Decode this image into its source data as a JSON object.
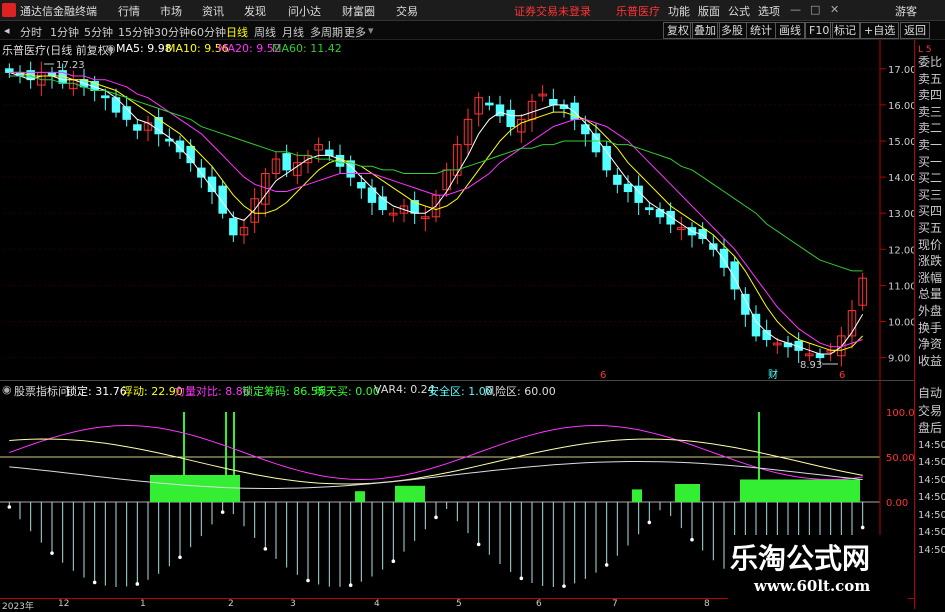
{
  "menubar": {
    "app_name": "通达信金融终端",
    "items": [
      "行情",
      "市场",
      "资讯",
      "发现",
      "问小达",
      "财富圈",
      "交易"
    ],
    "alert": "证券交易未登录",
    "stock": "乐普医疗",
    "right_items": [
      "功能",
      "版面",
      "公式",
      "选项"
    ],
    "guest": "游客"
  },
  "periodbar": {
    "periods": [
      "分时",
      "1分钟",
      "5分钟",
      "15分钟",
      "30分钟",
      "60分钟",
      "日线",
      "周线",
      "月线",
      "多周期",
      "更多"
    ],
    "active": "日线",
    "buttons": [
      "复权",
      "叠加",
      "多股",
      "统计",
      "画线",
      "F10",
      "标记",
      "+自选",
      "返回"
    ]
  },
  "main_info": {
    "title": "乐普医疗(日线 前复权)",
    "ma5": "MA5: 9.98",
    "ma10": "MA10: 9.56",
    "ma20": "MA20: 9.52",
    "ma60": "MA60: 11.42"
  },
  "price_axis": [
    "17.00",
    "16.00",
    "15.00",
    "14.00",
    "13.00",
    "12.00",
    "11.00",
    "10.00",
    "9.00"
  ],
  "annotations": {
    "high": "17.23",
    "low": "8.93"
  },
  "markers": {
    "m1": "6",
    "m2": "财",
    "m3": "6"
  },
  "sub_info": {
    "title": "股票指标问",
    "lock": "锁定: 31.76",
    "float": "浮动: 22.90",
    "power": "力量对比: 8.86",
    "chips": "锁定筹码: 86.55",
    "tomorrow": "明天买: 0.00",
    "var4": "VAR4: 0.24",
    "safe": "安全区: 1.00",
    "risk": "风险区: 60.00"
  },
  "sub_axis": [
    "100.0",
    "50.00",
    "0.00"
  ],
  "side_labels": [
    "委比",
    "卖五",
    "卖四",
    "卖三",
    "卖二",
    "卖一",
    "买一",
    "买二",
    "买三",
    "买四",
    "买五",
    "现价",
    "涨跌",
    "涨幅",
    "总量",
    "外盘",
    "换手",
    "净资",
    "收益"
  ],
  "side_lower": [
    "自动",
    "交易",
    "盘后",
    "14:50",
    "14:50",
    "14:50",
    "14:50",
    "14:50",
    "14:50",
    "14:50"
  ],
  "side_tag": "L 5",
  "time_axis": [
    "2023年",
    "12",
    "1",
    "2",
    "3",
    "4",
    "5",
    "6",
    "7",
    "8"
  ],
  "watermark": {
    "line1": "乐淘公式网",
    "line2": "www.60lt.com"
  },
  "colors": {
    "up": "#ff3333",
    "down": "#54ffff",
    "ma5": "#ffffff",
    "ma10": "#ffff00",
    "ma20": "#ff33ff",
    "ma60": "#33cc33"
  },
  "chart_data": {
    "type": "line",
    "title": "乐普医疗(日线 前复权)",
    "ylim": [
      8.6,
      17.3
    ],
    "closes": [
      16.9,
      16.8,
      16.7,
      16.9,
      16.8,
      16.6,
      16.7,
      16.5,
      16.4,
      16.2,
      15.8,
      15.6,
      15.3,
      15.5,
      15.2,
      15.0,
      14.7,
      14.4,
      14.0,
      13.6,
      13.0,
      12.4,
      12.6,
      13.4,
      14.1,
      14.5,
      14.2,
      14.4,
      14.6,
      14.9,
      14.6,
      14.3,
      14.0,
      13.7,
      13.3,
      13.1,
      13.0,
      13.2,
      13.0,
      12.9,
      13.5,
      14.2,
      14.9,
      15.6,
      16.2,
      16.0,
      15.7,
      15.4,
      15.6,
      16.1,
      16.3,
      16.0,
      15.9,
      15.6,
      15.2,
      14.7,
      14.2,
      13.8,
      13.6,
      13.3,
      13.1,
      12.9,
      12.7,
      12.6,
      12.4,
      12.3,
      12.0,
      11.5,
      10.9,
      10.2,
      9.6,
      9.5,
      9.4,
      9.3,
      9.2,
      9.1,
      9.0,
      9.2,
      9.6,
      10.3,
      11.2
    ],
    "series": [
      {
        "name": "MA5",
        "values": [
          16.9,
          16.8,
          16.7,
          16.8,
          16.8,
          16.7,
          16.7,
          16.6,
          16.5,
          16.4,
          16.2,
          15.9,
          15.6,
          15.5,
          15.3,
          15.1,
          14.8,
          14.5,
          14.1,
          13.7,
          13.3,
          12.9,
          12.8,
          13.1,
          13.5,
          13.9,
          14.1,
          14.3,
          14.5,
          14.6,
          14.6,
          14.5,
          14.3,
          14.0,
          13.7,
          13.4,
          13.2,
          13.1,
          13.0,
          13.0,
          13.2,
          13.6,
          14.1,
          14.6,
          15.2,
          15.6,
          15.8,
          15.7,
          15.7,
          15.8,
          15.9,
          16.0,
          16.0,
          15.8,
          15.5,
          15.1,
          14.7,
          14.3,
          13.9,
          13.6,
          13.3,
          13.1,
          12.9,
          12.7,
          12.5,
          12.4,
          12.1,
          11.7,
          11.2,
          10.6,
          10.0,
          9.7,
          9.5,
          9.4,
          9.3,
          9.2,
          9.1,
          9.1,
          9.3,
          9.7,
          10.2
        ]
      },
      {
        "name": "MA10",
        "values": [
          16.9,
          16.9,
          16.8,
          16.8,
          16.8,
          16.8,
          16.7,
          16.7,
          16.6,
          16.5,
          16.4,
          16.2,
          16.0,
          15.8,
          15.6,
          15.4,
          15.2,
          14.9,
          14.6,
          14.3,
          13.9,
          13.5,
          13.2,
          13.0,
          13.0,
          13.1,
          13.3,
          13.6,
          13.9,
          14.2,
          14.4,
          14.5,
          14.4,
          14.3,
          14.1,
          13.9,
          13.7,
          13.5,
          13.3,
          13.2,
          13.1,
          13.2,
          13.4,
          13.8,
          14.2,
          14.6,
          15.0,
          15.3,
          15.5,
          15.6,
          15.7,
          15.8,
          15.8,
          15.7,
          15.6,
          15.4,
          15.1,
          14.8,
          14.4,
          14.1,
          13.8,
          13.5,
          13.2,
          13.0,
          12.8,
          12.6,
          12.4,
          12.1,
          11.8,
          11.4,
          10.9,
          10.4,
          10.0,
          9.7,
          9.5,
          9.4,
          9.3,
          9.2,
          9.2,
          9.3,
          9.6
        ]
      },
      {
        "name": "MA20",
        "values": [
          16.9,
          16.9,
          16.9,
          16.9,
          16.9,
          16.9,
          16.8,
          16.8,
          16.7,
          16.7,
          16.6,
          16.5,
          16.3,
          16.2,
          16.0,
          15.8,
          15.6,
          15.4,
          15.2,
          14.9,
          14.6,
          14.3,
          14.0,
          13.8,
          13.7,
          13.6,
          13.6,
          13.7,
          13.8,
          13.9,
          14.0,
          14.1,
          14.1,
          14.1,
          14.1,
          14.0,
          13.9,
          13.8,
          13.7,
          13.6,
          13.5,
          13.5,
          13.6,
          13.7,
          13.9,
          14.1,
          14.4,
          14.6,
          14.8,
          15.0,
          15.2,
          15.4,
          15.5,
          15.6,
          15.6,
          15.5,
          15.4,
          15.2,
          15.0,
          14.7,
          14.4,
          14.1,
          13.8,
          13.5,
          13.2,
          12.9,
          12.6,
          12.3,
          12.0,
          11.6,
          11.2,
          10.8,
          10.4,
          10.1,
          9.8,
          9.6,
          9.4,
          9.3,
          9.3,
          9.4,
          9.5
        ]
      },
      {
        "name": "MA60",
        "values": [
          16.8,
          16.8,
          16.8,
          16.7,
          16.7,
          16.6,
          16.6,
          16.5,
          16.4,
          16.4,
          16.3,
          16.2,
          16.1,
          16.0,
          15.9,
          15.8,
          15.7,
          15.6,
          15.4,
          15.3,
          15.2,
          15.1,
          15.0,
          14.9,
          14.8,
          14.7,
          14.7,
          14.6,
          14.6,
          14.5,
          14.5,
          14.4,
          14.4,
          14.3,
          14.3,
          14.2,
          14.2,
          14.1,
          14.1,
          14.1,
          14.1,
          14.2,
          14.2,
          14.3,
          14.4,
          14.5,
          14.6,
          14.7,
          14.8,
          14.8,
          14.9,
          14.9,
          15.0,
          15.0,
          15.0,
          15.0,
          15.0,
          14.9,
          14.9,
          14.8,
          14.7,
          14.6,
          14.5,
          14.3,
          14.2,
          14.0,
          13.8,
          13.6,
          13.4,
          13.2,
          13.0,
          12.7,
          12.5,
          12.3,
          12.1,
          11.9,
          11.7,
          11.6,
          11.5,
          11.4,
          11.4
        ]
      }
    ]
  }
}
